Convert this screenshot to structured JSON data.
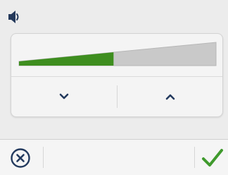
{
  "header": {
    "icon": "speaker-icon"
  },
  "volume": {
    "level": 0.48,
    "fill_color": "#3e8e1f",
    "track_color": "#c9c9c9"
  },
  "controls": {
    "down_icon": "chevron-down-icon",
    "up_icon": "chevron-up-icon",
    "icon_color": "#233a5e"
  },
  "footer": {
    "cancel_icon": "close-circle-icon",
    "confirm_icon": "checkmark-icon",
    "confirm_color": "#3f9a2d"
  }
}
